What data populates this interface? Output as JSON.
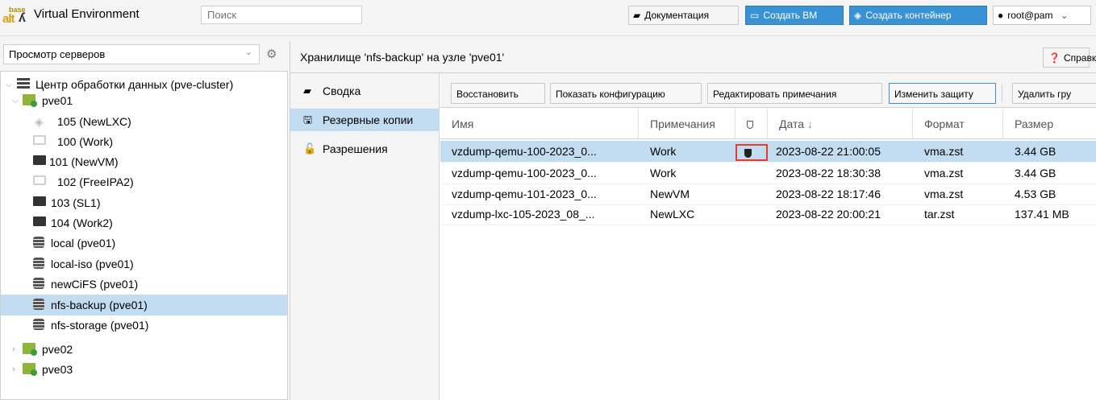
{
  "app": {
    "logo_top": "base",
    "logo_bottom": "alt",
    "title": "Virtual Environment"
  },
  "search": {
    "placeholder": "Поиск"
  },
  "topbar": {
    "docs": "Документация",
    "create_vm": "Создать ВМ",
    "create_ct": "Создать контейнер",
    "user": "root@pam"
  },
  "left": {
    "view": "Просмотр серверов",
    "tree": [
      {
        "label": "Центр обработки данных (pve-cluster)",
        "icon": "datacenter-icon"
      },
      {
        "label": "pve01",
        "icon": "node-online-icon"
      },
      {
        "label": "105 (NewLXC)",
        "icon": "container-icon"
      },
      {
        "label": "100 (Work)",
        "icon": "vm-stopped-icon"
      },
      {
        "label": "101 (NewVM)",
        "icon": "vm-template-icon"
      },
      {
        "label": "102 (FreeIPA2)",
        "icon": "vm-stopped-icon"
      },
      {
        "label": "103 (SL1)",
        "icon": "vm-running-icon"
      },
      {
        "label": "104 (Work2)",
        "icon": "vm-running-icon"
      },
      {
        "label": "local (pve01)",
        "icon": "storage-icon"
      },
      {
        "label": "local-iso (pve01)",
        "icon": "storage-icon"
      },
      {
        "label": "newCiFS (pve01)",
        "icon": "storage-icon"
      },
      {
        "label": "nfs-backup (pve01)",
        "icon": "storage-icon"
      },
      {
        "label": "nfs-storage (pve01)",
        "icon": "storage-icon"
      },
      {
        "label": "pve02",
        "icon": "node-online-icon"
      },
      {
        "label": "pve03",
        "icon": "node-online-icon"
      }
    ]
  },
  "content": {
    "title": "Хранилище 'nfs-backup' на узле 'pve01'",
    "help": "Справка",
    "nav": [
      "Сводка",
      "Резервные копии",
      "Разрешения"
    ],
    "toolbar": {
      "restore": "Восстановить",
      "show_config": "Показать конфигурацию",
      "edit_notes": "Редактировать примечания",
      "change_protection": "Изменить защиту",
      "remove_group": "Удалить гру"
    },
    "columns": {
      "name": "Имя",
      "notes": "Примечания",
      "date": "Дата",
      "format": "Формат",
      "size": "Размер"
    },
    "rows": [
      {
        "name": "vzdump-qemu-100-2023_0...",
        "notes": "Work",
        "protected": true,
        "date": "2023-08-22 21:00:05",
        "format": "vma.zst",
        "size": "3.44 GB"
      },
      {
        "name": "vzdump-qemu-100-2023_0...",
        "notes": "Work",
        "protected": false,
        "date": "2023-08-22 18:30:38",
        "format": "vma.zst",
        "size": "3.44 GB"
      },
      {
        "name": "vzdump-qemu-101-2023_0...",
        "notes": "NewVM",
        "protected": false,
        "date": "2023-08-22 18:17:46",
        "format": "vma.zst",
        "size": "4.53 GB"
      },
      {
        "name": "vzdump-lxc-105-2023_08_...",
        "notes": "NewLXC",
        "protected": false,
        "date": "2023-08-22 20:00:21",
        "format": "tar.zst",
        "size": "137.41 MB"
      }
    ]
  },
  "colors": {
    "accent": "#3892d4",
    "selection": "#c2ddf2",
    "highlight": "#e0402a"
  }
}
